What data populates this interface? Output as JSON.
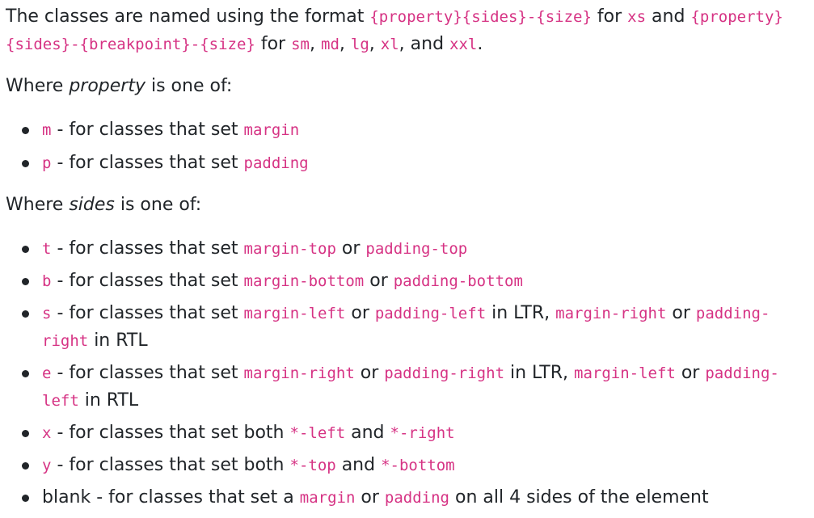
{
  "intro": {
    "t1": "The classes are named using the format ",
    "c1": "{property}{sides}-{size}",
    "t2": " for ",
    "c2": "xs",
    "t3": " and ",
    "c3": "{property}{sides}-{breakpoint}-{size}",
    "t4": " for ",
    "c4": "sm",
    "t5": ", ",
    "c5": "md",
    "t6": ", ",
    "c6": "lg",
    "t7": ", ",
    "c7": "xl",
    "t8": ", and ",
    "c8": "xxl",
    "t9": "."
  },
  "property_heading": {
    "before": "Where ",
    "term": "property",
    "after": " is one of:"
  },
  "property_items": [
    {
      "code": "m",
      "text": " - for classes that set ",
      "code2": "margin"
    },
    {
      "code": "p",
      "text": " - for classes that set ",
      "code2": "padding"
    }
  ],
  "sides_heading": {
    "before": "Where ",
    "term": "sides",
    "after": " is one of:"
  },
  "sides_items": [
    {
      "code": "t",
      "text1": " - for classes that set ",
      "code2": "margin-top",
      "text2": " or ",
      "code3": "padding-top"
    },
    {
      "code": "b",
      "text1": " - for classes that set ",
      "code2": "margin-bottom",
      "text2": " or ",
      "code3": "padding-bottom"
    },
    {
      "code": "s",
      "text1": " - for classes that set ",
      "code2": "margin-left",
      "text2": " or ",
      "code3": "padding-left",
      "text3": " in LTR, ",
      "code4": "margin-right",
      "text4": " or ",
      "code5": "padding-right",
      "text5": " in RTL"
    },
    {
      "code": "e",
      "text1": " - for classes that set ",
      "code2": "margin-right",
      "text2": " or ",
      "code3": "padding-right",
      "text3": " in LTR, ",
      "code4": "margin-left",
      "text4": " or ",
      "code5": "padding-left",
      "text5": " in RTL"
    },
    {
      "code": "x",
      "text1": " - for classes that set both ",
      "code2": "*-left",
      "text2": " and ",
      "code3": "*-right"
    },
    {
      "code": "y",
      "text1": " - for classes that set both ",
      "code2": "*-top",
      "text2": " and ",
      "code3": "*-bottom"
    },
    {
      "text0": "blank - for classes that set a ",
      "code2": "margin",
      "text2": " or ",
      "code3": "padding",
      "text3": " on all 4 sides of the element"
    }
  ],
  "colors": {
    "text": "#212529",
    "code": "#d63384",
    "background": "#ffffff"
  }
}
